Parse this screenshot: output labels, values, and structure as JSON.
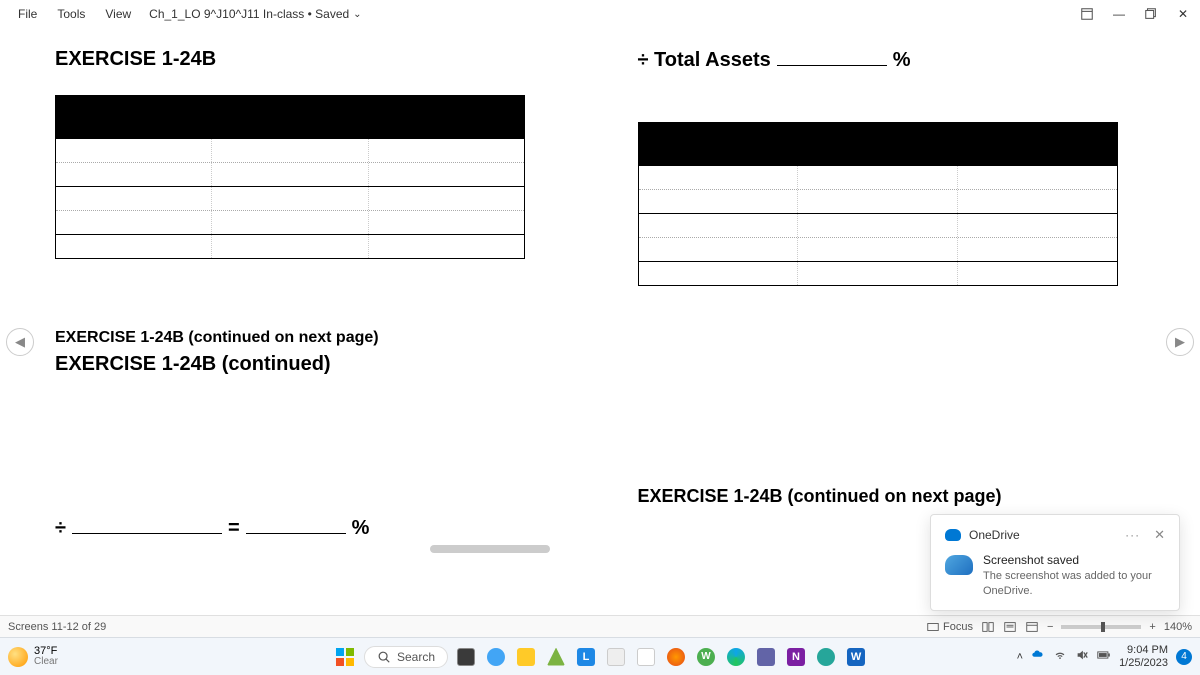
{
  "menu": {
    "file": "File",
    "tools": "Tools",
    "view": "View"
  },
  "document": {
    "name": "Ch_1_LO 9^J10^J11 In-class • Saved"
  },
  "window_controls": {
    "ribbon_opts": "⇕",
    "minimize": "—",
    "restore": "▢",
    "close": "✕"
  },
  "left_page": {
    "title": "EXERCISE 1-24B",
    "cont_line": "EXERCISE 1-24B (continued on next page)",
    "cont_title": "EXERCISE 1-24B (continued)",
    "formula_div": "÷",
    "formula_eq": "=",
    "formula_pct": "%"
  },
  "right_page": {
    "head_prefix": "÷ Total Assets",
    "head_pct": "%",
    "cont_line": "EXERCISE 1-24B (continued on next page)"
  },
  "nav": {
    "prev": "◀",
    "next": "▶"
  },
  "status": {
    "screens": "Screens 11-12 of 29",
    "focus": "Focus",
    "zoom": "140%"
  },
  "taskbar": {
    "temp": "37°F",
    "condition": "Clear",
    "search": "Search"
  },
  "tray": {
    "chevron": "˄",
    "wifi": "⌔",
    "sound": "🔇",
    "battery": "▣",
    "time": "9:04 PM",
    "date": "1/25/2023",
    "notif_count": "4"
  },
  "onedrive": {
    "brand": "OneDrive",
    "more": "···",
    "close": "✕",
    "msg_title": "Screenshot saved",
    "msg_body": "The screenshot was added to your OneDrive."
  }
}
